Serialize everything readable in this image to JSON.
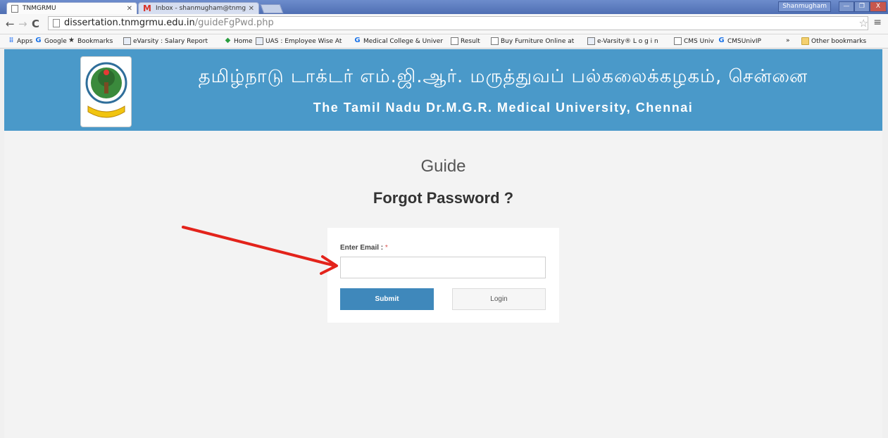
{
  "browser": {
    "tabs": [
      {
        "title": "TNMGRMU",
        "active": true
      },
      {
        "title": "Inbox - shanmugham@tnmgr",
        "active": false
      }
    ],
    "profile_name": "Shanmugham",
    "window_buttons": {
      "minimize": "—",
      "maximize": "❐",
      "close": "X"
    },
    "address": {
      "host": "dissertation.tnmgrmu.edu.in",
      "path": "/guideFgPwd.php"
    },
    "bookmarks": [
      {
        "label": "Apps",
        "icon": "apps-icon"
      },
      {
        "label": "Google",
        "icon": "google-icon"
      },
      {
        "label": "Bookmarks",
        "icon": "star-icon"
      },
      {
        "label": "eVarsity : Salary Report",
        "icon": "chart-icon"
      },
      {
        "label": "Home",
        "icon": "home-icon"
      },
      {
        "label": "UAS : Employee Wise At",
        "icon": "chart-icon"
      },
      {
        "label": "Medical College & Univer",
        "icon": "google-icon"
      },
      {
        "label": "Result",
        "icon": "page-icon"
      },
      {
        "label": "Buy Furniture Online at",
        "icon": "page-icon"
      },
      {
        "label": "e-Varsity® L o g i n",
        "icon": "chart-icon"
      },
      {
        "label": "CMS Univ",
        "icon": "page-icon"
      },
      {
        "label": "CMSUnivIP",
        "icon": "google-icon"
      },
      {
        "label": "»",
        "icon": ""
      },
      {
        "label": "Other bookmarks",
        "icon": "folder-icon"
      }
    ]
  },
  "banner": {
    "tamil_title": "தமிழ்நாடு டாக்டர் எம்.ஜி.ஆர். மருத்துவப் பல்கலைக்கழகம், சென்னை",
    "english_title": "The Tamil Nadu Dr.M.G.R. Medical University, Chennai",
    "background_color": "#4a99c9"
  },
  "main": {
    "role_heading": "Guide",
    "form_heading": "Forgot Password ?",
    "email_label": "Enter Email :",
    "required_mark": "*",
    "email_value": "",
    "submit_label": "Submit",
    "login_label": "Login"
  },
  "colors": {
    "accent": "#3f88bb",
    "annotation_arrow": "#e3231b"
  }
}
